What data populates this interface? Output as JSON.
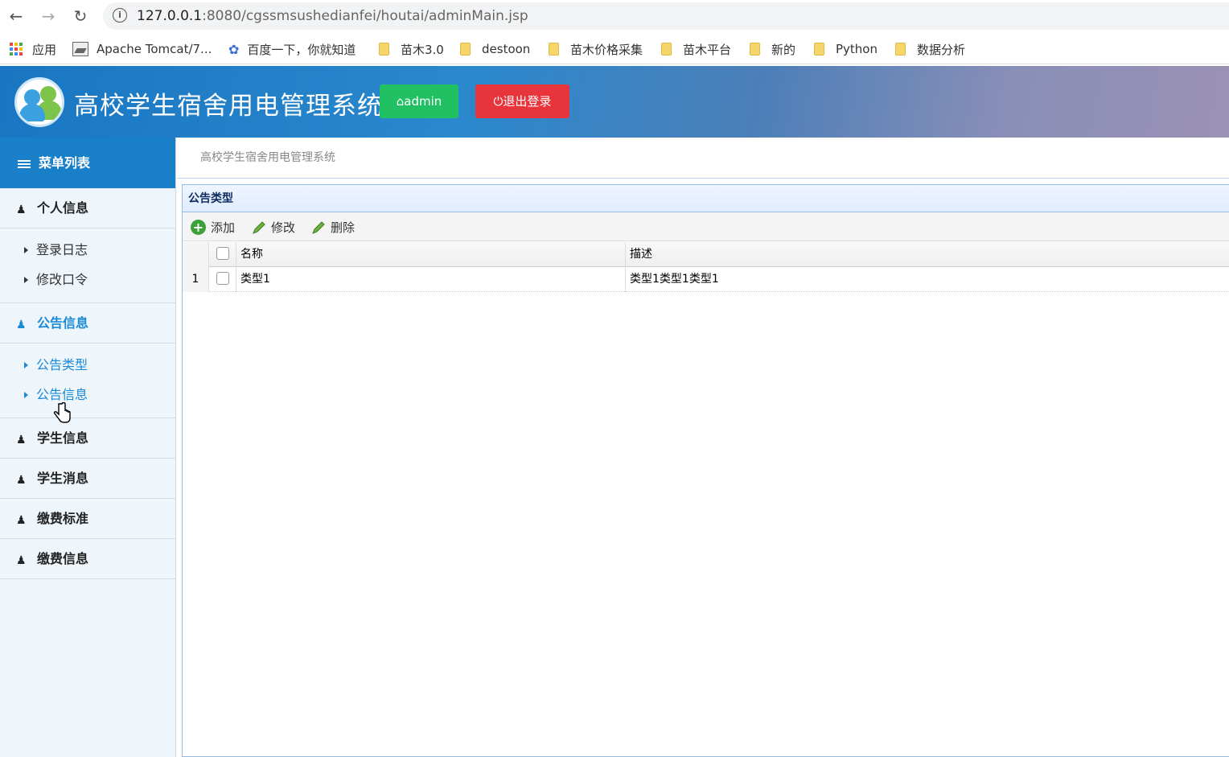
{
  "browser": {
    "url_host": "127.0.0.1",
    "url_path": ":8080/cgssmsushedianfei/houtai/adminMain.jsp",
    "bookmarks": [
      {
        "label": "应用",
        "icon": "apps-icon"
      },
      {
        "label": "Apache Tomcat/7...",
        "icon": "image-icon"
      },
      {
        "label": "百度一下，你就知道",
        "icon": "baidu-paw-icon"
      },
      {
        "label": "苗木3.0",
        "icon": "folder-icon"
      },
      {
        "label": "destoon",
        "icon": "folder-icon"
      },
      {
        "label": "苗木价格采集",
        "icon": "folder-icon"
      },
      {
        "label": "苗木平台",
        "icon": "folder-icon"
      },
      {
        "label": "新的",
        "icon": "folder-icon"
      },
      {
        "label": "Python",
        "icon": "folder-icon"
      },
      {
        "label": "数据分析",
        "icon": "folder-icon"
      }
    ]
  },
  "header": {
    "title": "高校学生宿舍用电管理系统",
    "admin_label": "admin",
    "logout_label": "退出登录",
    "colors": {
      "admin": "#21c163",
      "logout": "#e8343b"
    }
  },
  "sidebar": {
    "heading": "菜单列表",
    "groups": [
      {
        "label": "个人信息",
        "items": [
          "登录日志",
          "修改口令"
        ]
      },
      {
        "label": "公告信息",
        "items": [
          "公告类型",
          "公告信息"
        ]
      },
      {
        "label": "学生信息"
      },
      {
        "label": "学生消息"
      },
      {
        "label": "缴费标准"
      },
      {
        "label": "缴费信息"
      }
    ]
  },
  "main": {
    "breadcrumb": "高校学生宿舍用电管理系统",
    "panel_title": "公告类型",
    "toolbar": {
      "add": "添加",
      "edit": "修改",
      "delete": "删除"
    },
    "columns": [
      "名称",
      "描述"
    ],
    "rows": [
      {
        "num": "1",
        "name": "类型1",
        "desc": "类型1类型1类型1"
      }
    ]
  }
}
